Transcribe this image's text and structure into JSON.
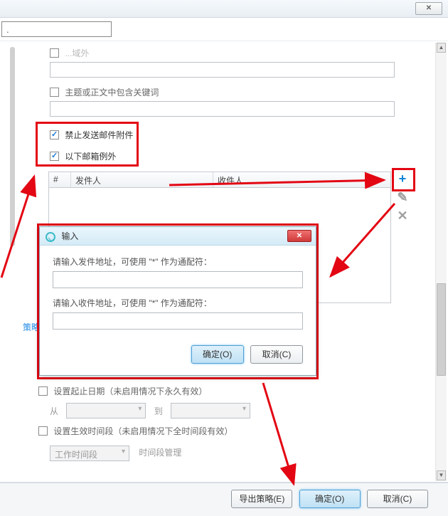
{
  "top": {
    "address_value": ".",
    "close_glyph": "✕"
  },
  "truncated_checkbox_text": "...域外",
  "keyword_checkbox": "主题或正文中包含关键词",
  "forbid_attach_checkbox": "禁止发送邮件附件",
  "except_emails_checkbox": "以下邮箱例外",
  "table": {
    "col_num": "#",
    "col_sender": "发件人",
    "col_recipient": "收件人"
  },
  "policy_link_text": "策略",
  "effective_date_checkbox": "设置起止日期（未启用情况下永久有效）",
  "from_label": "从",
  "to_label": "到",
  "effective_time_checkbox": "设置生效时间段（未启用情况下全时间段有效）",
  "work_time_select": "工作时间段",
  "time_manage_label": "时间段管理",
  "modal": {
    "title": "输入",
    "sender_prompt": "请输入发件地址，可使用 \"*\" 作为通配符：",
    "recipient_prompt": "请输入收件地址，可使用 \"*\" 作为通配符：",
    "ok": "确定(O)",
    "cancel": "取消(C)"
  },
  "bottom": {
    "export": "导出策略(E)",
    "ok": "确定(O)",
    "cancel": "取消(C)"
  },
  "colors": {
    "highlight_red": "#e30613",
    "primary_blue": "#0a84d6"
  }
}
